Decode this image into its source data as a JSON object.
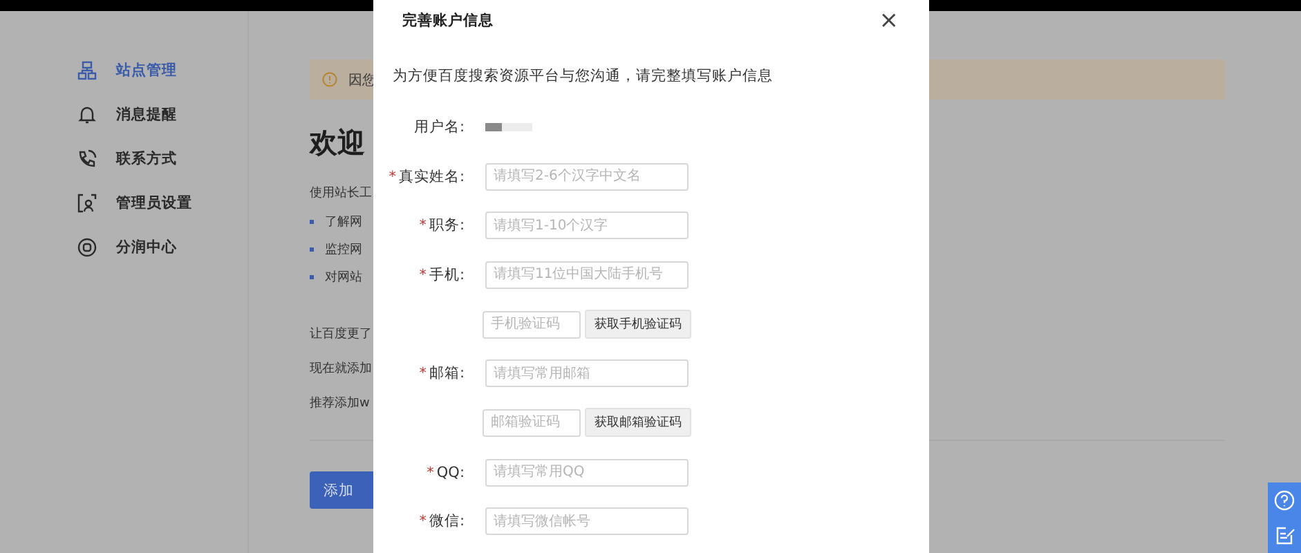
{
  "sidebar": {
    "items": [
      {
        "label": "站点管理",
        "selected": true
      },
      {
        "label": "消息提醒",
        "selected": false
      },
      {
        "label": "联系方式",
        "selected": false
      },
      {
        "label": "管理员设置",
        "selected": false
      },
      {
        "label": "分润中心",
        "selected": false
      }
    ]
  },
  "main": {
    "notice": "因您",
    "heading": "欢迎",
    "intro": "使用站长工",
    "bullets": [
      "了解网",
      "监控网",
      "对网站"
    ],
    "paragraph": [
      "让百度更了",
      "现在就添加",
      "推荐添加w"
    ],
    "add_button": "添加"
  },
  "dialog": {
    "title": "完善账户信息",
    "close": "×",
    "description": "为方便百度搜索资源平台与您沟通，请完整填写账户信息",
    "required_mark": "*",
    "rows": [
      {
        "kind": "static",
        "label": "用户名:"
      },
      {
        "kind": "field",
        "label": "真实姓名:",
        "required": true,
        "placeholder": "请填写2-6个汉字中文名"
      },
      {
        "kind": "field",
        "label": "职务:",
        "required": true,
        "placeholder": "请填写1-10个汉字"
      },
      {
        "kind": "field",
        "label": "手机:",
        "required": true,
        "placeholder": "请填写11位中国大陆手机号"
      },
      {
        "kind": "code",
        "placeholder": "手机验证码",
        "button": "获取手机验证码"
      },
      {
        "kind": "field",
        "label": "邮箱:",
        "required": true,
        "placeholder": "请填写常用邮箱"
      },
      {
        "kind": "code",
        "placeholder": "邮箱验证码",
        "button": "获取邮箱验证码"
      },
      {
        "kind": "field",
        "label": "QQ:",
        "required": true,
        "placeholder": "请填写常用QQ"
      },
      {
        "kind": "field",
        "label": "微信:",
        "required": true,
        "placeholder": "请填写微信帐号"
      }
    ]
  }
}
